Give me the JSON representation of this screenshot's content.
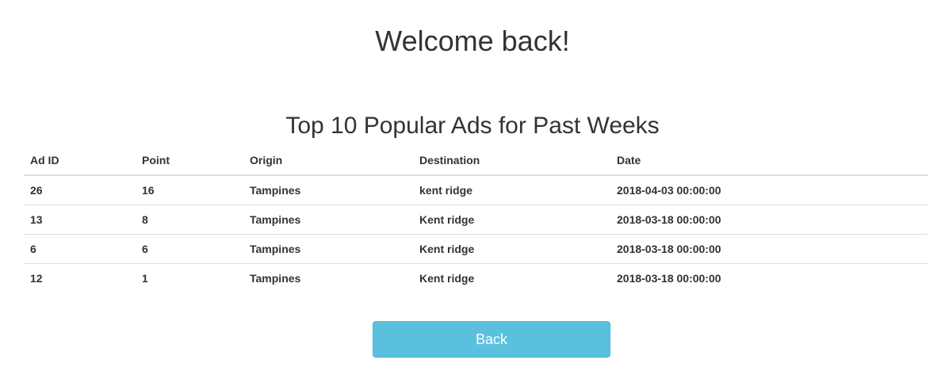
{
  "heading": "Welcome back!",
  "table": {
    "title": "Top 10 Popular Ads for Past Weeks",
    "columns": [
      "Ad ID",
      "Point",
      "Origin",
      "Destination",
      "Date"
    ],
    "rows": [
      [
        "26",
        "16",
        "Tampines",
        "kent ridge",
        "2018-04-03 00:00:00"
      ],
      [
        "13",
        "8",
        "Tampines",
        "Kent ridge",
        "2018-03-18 00:00:00"
      ],
      [
        "6",
        "6",
        "Tampines",
        "Kent ridge",
        "2018-03-18 00:00:00"
      ],
      [
        "12",
        "1",
        "Tampines",
        "Kent ridge",
        "2018-03-18 00:00:00"
      ]
    ]
  },
  "back_button": {
    "label": "Back",
    "color": "#5bc0de"
  }
}
